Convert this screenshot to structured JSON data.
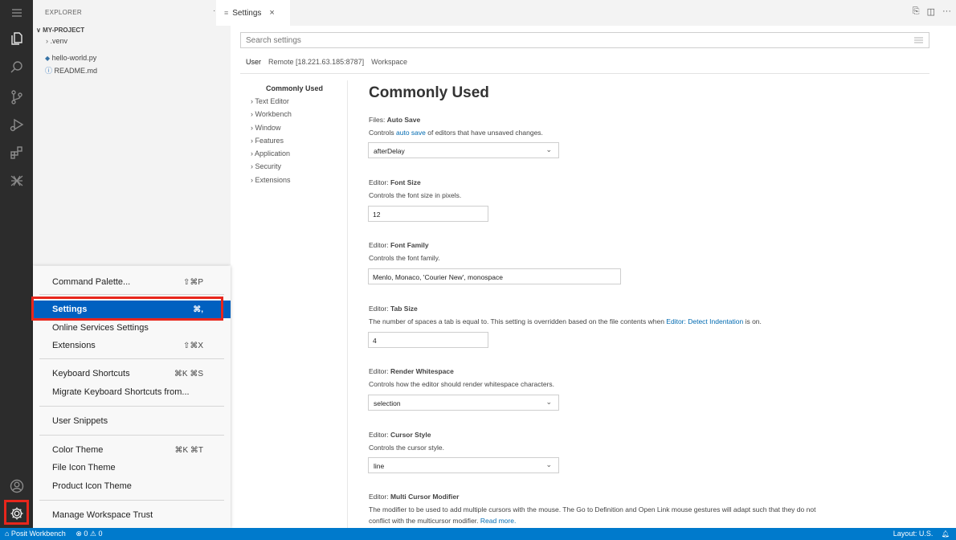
{
  "explorer": {
    "title": "EXPLORER",
    "more": "···",
    "project": "MY-PROJECT",
    "items": [
      ".venv",
      "hello-world.py",
      "README.md"
    ]
  },
  "editor_tab": {
    "label": "Settings",
    "close": "×",
    "actions": [
      "split-editor-icon",
      "more-actions-icon"
    ]
  },
  "settings": {
    "search_placeholder": "Search settings",
    "scopes": [
      "User",
      "Remote [18.221.63.185:8787]",
      "Workspace"
    ],
    "toc": [
      "Commonly Used",
      "Text Editor",
      "Workbench",
      "Window",
      "Features",
      "Application",
      "Security",
      "Extensions"
    ],
    "section_title": "Commonly Used",
    "items": [
      {
        "prefix": "Files: ",
        "name": "Auto Save",
        "desc_before": "Controls ",
        "desc_link": "auto save",
        "desc_after": " of editors that have unsaved changes.",
        "value": "afterDelay"
      },
      {
        "prefix": "Editor: ",
        "name": "Font Size",
        "desc": "Controls the font size in pixels.",
        "value": "12"
      },
      {
        "prefix": "Editor: ",
        "name": "Font Family",
        "desc": "Controls the font family.",
        "value": "Menlo, Monaco, 'Courier New', monospace"
      },
      {
        "prefix": "Editor: ",
        "name": "Tab Size",
        "desc_before": "The number of spaces a tab is equal to. This setting is overridden based on the file contents when ",
        "desc_link": "Editor: Detect Indentation",
        "desc_after": " is on.",
        "value": "4"
      },
      {
        "prefix": "Editor: ",
        "name": "Render Whitespace",
        "desc": "Controls how the editor should render whitespace characters.",
        "value": "selection"
      },
      {
        "prefix": "Editor: ",
        "name": "Cursor Style",
        "desc": "Controls the cursor style.",
        "value": "line"
      },
      {
        "prefix": "Editor: ",
        "name": "Multi Cursor Modifier",
        "desc_line1": "The modifier to be used to add multiple cursors with the mouse. The Go to Definition and Open Link mouse gestures will adapt such that they do not",
        "desc_line2_before": "conflict with the multicursor modifier. ",
        "desc_link": "Read more."
      }
    ]
  },
  "manage_menu": {
    "items": [
      {
        "label": "Command Palette...",
        "shortcut": "⇧⌘P"
      },
      {
        "label": "Settings",
        "shortcut": "⌘,"
      },
      {
        "label": "Online Services Settings",
        "shortcut": ""
      },
      {
        "label": "Extensions",
        "shortcut": "⇧⌘X"
      },
      {
        "label": "Keyboard Shortcuts",
        "shortcut": "⌘K ⌘S"
      },
      {
        "label": "Migrate Keyboard Shortcuts from...",
        "shortcut": ""
      },
      {
        "label": "User Snippets",
        "shortcut": ""
      },
      {
        "label": "Color Theme",
        "shortcut": "⌘K ⌘T"
      },
      {
        "label": "File Icon Theme",
        "shortcut": ""
      },
      {
        "label": "Product Icon Theme",
        "shortcut": ""
      },
      {
        "label": "Manage Workspace Trust",
        "shortcut": ""
      }
    ]
  },
  "statusbar": {
    "remote": "⌂ Posit Workbench",
    "problems": "⊗ 0 ⚠ 0",
    "layout": "Layout: U.S.",
    "bell": "🔔"
  },
  "colors": {
    "activity_bar": "#2c2c2c",
    "status_bar": "#007acc",
    "highlight": "#0060c0",
    "annotation": "#e8261c",
    "link": "#006ab1"
  }
}
